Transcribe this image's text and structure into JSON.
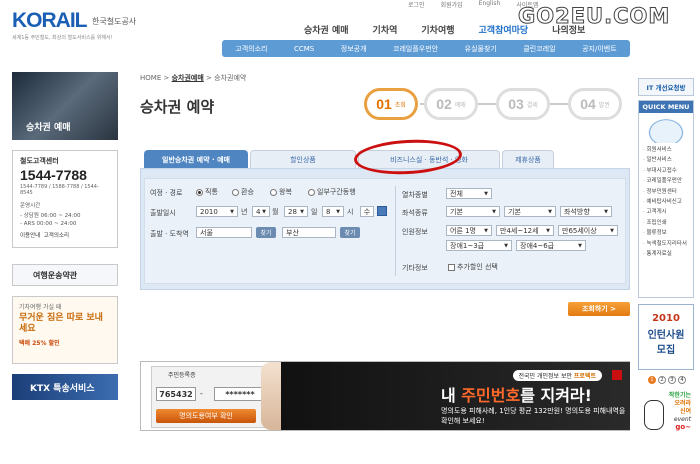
{
  "logo": {
    "brand": "KORAIL",
    "name_ko": "한국철도공사",
    "slogan": "세계1등 주민철도, 최상의 철도서비스를 위해서!"
  },
  "watermark": "GO2EU.COM",
  "utility": {
    "items": [
      "로그인",
      "회원가입",
      "English",
      "사이트맵"
    ]
  },
  "main_nav": {
    "items": [
      "승차권 예매",
      "기차역",
      "기차여행",
      "고객참여마당",
      "나의정보"
    ],
    "active": "고객참여마당"
  },
  "sub_nav": {
    "items": [
      "고객의소리",
      "CCMS",
      "정보공개",
      "코레일플우펀안",
      "유실물찾기",
      "클린코레일",
      "공지/이벤트"
    ]
  },
  "left": {
    "ticket_banner": "승차권 예매",
    "call": {
      "title": "철도고객센터",
      "number": "1544-7788",
      "alt": "1544-7789 / 1588-7788 / 1544-8545",
      "hours_label": "운영시간",
      "hours": [
        "- 상담원  06:00 ~ 24:00",
        "- ARS    00:00 ~ 24:00"
      ],
      "links": [
        "이용안내",
        "고객의소리"
      ]
    },
    "terms": "여행운송약관",
    "parcel": {
      "a": "기차여행 가실 때",
      "b": "무거운 짐은 따로 보내세요",
      "c": "택배 25% 할인"
    },
    "ktx": "KTX 특송서비스"
  },
  "breadcrumb": {
    "home": "HOME",
    "parent": "승차권예매",
    "current": "승차권예약",
    "sep": ">"
  },
  "page_title": "승차권 예약",
  "steps": [
    {
      "num": "01",
      "label": "조회"
    },
    {
      "num": "02",
      "label": "예매"
    },
    {
      "num": "03",
      "label": "결제"
    },
    {
      "num": "04",
      "label": "발권"
    }
  ],
  "tabs": [
    "일반승차권 예약 · 예매",
    "할인상품",
    "비즈니스실 · 동반석 · 영화",
    "제휴상품"
  ],
  "form": {
    "trip_label": "여정 · 경로",
    "trip_options": [
      "직통",
      "환승",
      "왕복",
      "일부구간동행"
    ],
    "date_label": "출발일시",
    "year": "2010",
    "year_unit": "년",
    "month": "4",
    "month_unit": "월",
    "day": "28",
    "day_unit": "일",
    "hour": "8",
    "hour_unit": "시",
    "hour_sel": "수",
    "station_label": "출발 · 도착역",
    "from": "서울",
    "to": "부산",
    "find_btn": "찾기",
    "train_label": "열차종별",
    "train_value": "전체",
    "seat_label": "좌석종류",
    "seat_values": [
      "기본",
      "기본",
      "좌석방향"
    ],
    "passenger_label": "인원정보",
    "passenger_values": [
      "어른 1명",
      "만4세~12세",
      "만65세이상",
      "장애1~3급",
      "장애4~6급"
    ],
    "extra_label": "기타정보",
    "extra_value": "추가할인 선택"
  },
  "search_btn": "조회하기 >",
  "id_banner": {
    "caption": "주민등록증",
    "id1": "765432",
    "id2": "*******",
    "dash": "-",
    "check_btn": "명의도용여부 확인",
    "notice_a": "전국민 개인정보 보안 ",
    "notice_b": "프로텍트",
    "headline_a": "내 ",
    "headline_b": "주민번호",
    "headline_c": "를 지켜라!",
    "sub": "명의도용 피해사례, 1인당 평균 132만원! 명의도용 피해내역을 확인해 보세요!"
  },
  "right": {
    "it": "IT 개선요청방",
    "quick_title": "QUICK MENU",
    "quick_items": [
      "회원서비스",
      "일반서비스",
      "부대사고접수",
      "코레일플우펀안",
      "정부민원센터",
      "예비탑사비신고",
      "고객게시",
      "조립인쇄",
      "물류정보",
      "녹색철도지리타서",
      "통계자료실"
    ],
    "recruit": {
      "year": "2010",
      "line1": "인턴사원",
      "line2": "모집"
    },
    "pager": [
      "1",
      "2",
      "3",
      "4"
    ],
    "event": {
      "t1": "착한기는",
      "t2": "오려라",
      "t3": "신여",
      "label": "event",
      "go": "go~"
    }
  }
}
